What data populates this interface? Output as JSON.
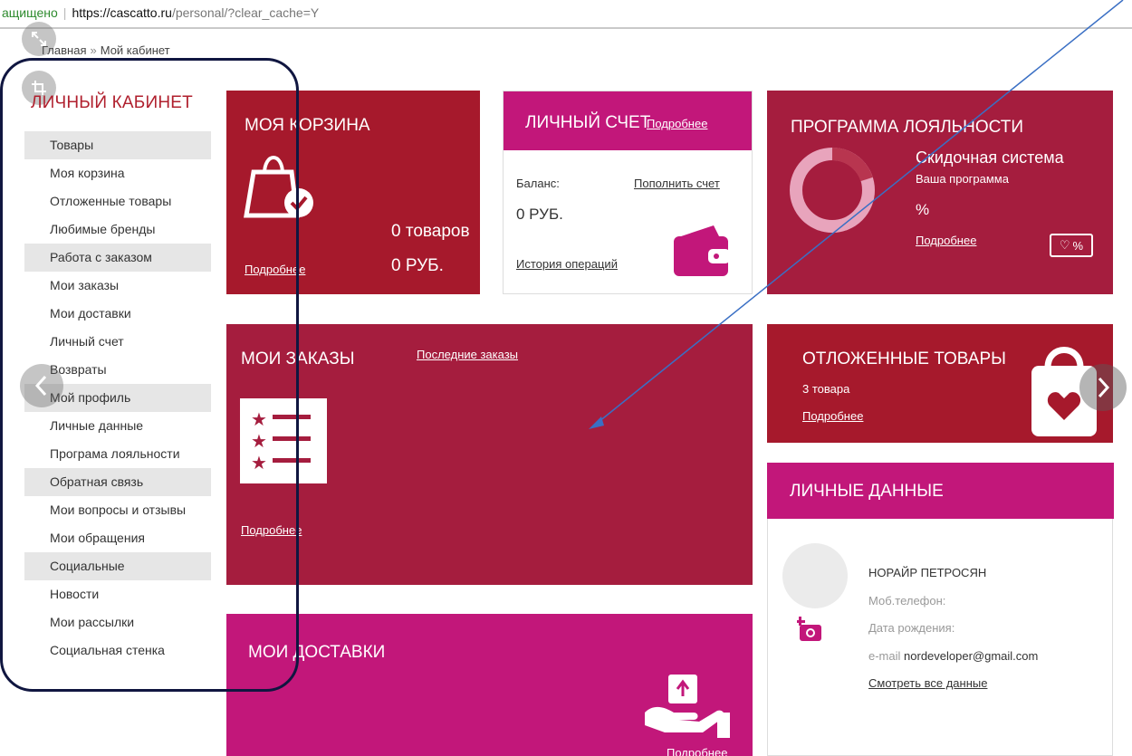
{
  "browser": {
    "security_text": "ащищено",
    "url_host": "https://cascatto.ru",
    "url_path": "/personal/?clear_cache=Y"
  },
  "breadcrumb": {
    "home": "Главная",
    "separator": "»",
    "current": "Мой кабинет"
  },
  "sidebar": {
    "title": "ЛИЧНЫЙ КАБИНЕТ",
    "items": [
      {
        "label": "Товары",
        "group": true
      },
      {
        "label": "Моя корзина",
        "group": false
      },
      {
        "label": "Отложенные товары",
        "group": false
      },
      {
        "label": "Любимые бренды",
        "group": false
      },
      {
        "label": "Работа с заказом",
        "group": true
      },
      {
        "label": "Мои заказы",
        "group": false
      },
      {
        "label": "Мои доставки",
        "group": false
      },
      {
        "label": "Личный счет",
        "group": false
      },
      {
        "label": "Возвраты",
        "group": false
      },
      {
        "label": "Мой профиль",
        "group": true
      },
      {
        "label": "Личные данные",
        "group": false
      },
      {
        "label": "Програма лояльности",
        "group": false
      },
      {
        "label": "Обратная связь",
        "group": true
      },
      {
        "label": "Мои вопросы и отзывы",
        "group": false
      },
      {
        "label": "Мои обращения",
        "group": false
      },
      {
        "label": "Социальные",
        "group": true
      },
      {
        "label": "Новости",
        "group": false
      },
      {
        "label": "Мои рассылки",
        "group": false
      },
      {
        "label": "Социальная стенка",
        "group": false
      }
    ]
  },
  "cart": {
    "title": "МОЯ КОРЗИНА",
    "count": "0 товаров",
    "sum": "0 РУБ.",
    "more": "Подробнее"
  },
  "account": {
    "title": "ЛИЧНЫЙ СЧЕТ",
    "more": "Подробнее",
    "balance_label": "Баланс:",
    "topup": "Пополнить счет",
    "balance_value": "0 РУБ.",
    "history": "История операций"
  },
  "loyalty": {
    "title": "ПРОГРАММА ЛОЯЛЬНОСТИ",
    "system": "Скидочная система",
    "program": "Ваша программа",
    "percent": "%",
    "more": "Подробнее",
    "badge": "%"
  },
  "orders": {
    "title": "МОИ ЗАКАЗЫ",
    "recent": "Последние заказы",
    "more": "Подробнее"
  },
  "deferred": {
    "title": "ОТЛОЖЕННЫЕ ТОВАРЫ",
    "count": "3 товара",
    "more": "Подробнее"
  },
  "personal": {
    "title": "ЛИЧНЫЕ ДАННЫЕ",
    "name": "НОРАЙР ПЕТРОСЯН",
    "phone_label": "Моб.телефон:",
    "birth_label": "Дата рождения:",
    "email_label": "e-mail",
    "email_value": "nordeveloper@gmail.com",
    "view_all": "Смотреть все данные"
  },
  "deliveries": {
    "title": "МОИ ДОСТАВКИ",
    "more": "Подробнее"
  },
  "colors": {
    "red": "#a6192c",
    "crimson": "#a51d3e",
    "magenta": "#c2177a",
    "annotation_box": "#101640",
    "annotation_arrow": "#3a6fc4"
  }
}
